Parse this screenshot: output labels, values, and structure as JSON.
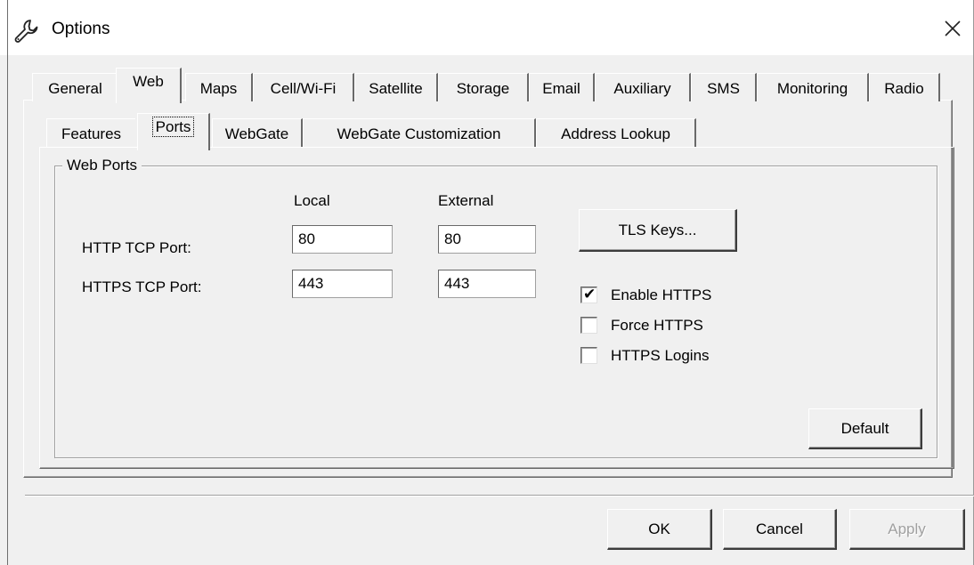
{
  "window": {
    "title": "Options",
    "icon": "wrench-icon",
    "close_icon": "close-icon"
  },
  "outer_tabs": [
    {
      "label": "General"
    },
    {
      "label": "Web"
    },
    {
      "label": "Maps"
    },
    {
      "label": "Cell/Wi-Fi"
    },
    {
      "label": "Satellite"
    },
    {
      "label": "Storage"
    },
    {
      "label": "Email"
    },
    {
      "label": "Auxiliary"
    },
    {
      "label": "SMS"
    },
    {
      "label": "Monitoring"
    },
    {
      "label": "Radio"
    }
  ],
  "outer_tab_active": "Web",
  "inner_tabs": [
    {
      "label": "Features"
    },
    {
      "label": "Ports"
    },
    {
      "label": "WebGate"
    },
    {
      "label": "WebGate Customization"
    },
    {
      "label": "Address Lookup"
    }
  ],
  "inner_tab_active": "Ports",
  "group": {
    "title": "Web Ports",
    "col_local": "Local",
    "col_external": "External",
    "http_label": "HTTP TCP Port:",
    "https_label": "HTTPS TCP Port:",
    "http_local": "80",
    "http_external": "80",
    "https_local": "443",
    "https_external": "443",
    "tls_button": "TLS Keys...",
    "enable_https": {
      "label": "Enable HTTPS",
      "checked": true
    },
    "force_https": {
      "label": "Force HTTPS",
      "checked": false
    },
    "https_logins": {
      "label": "HTTPS Logins",
      "checked": false
    },
    "default_button": "Default"
  },
  "footer": {
    "ok": "OK",
    "cancel": "Cancel",
    "apply": "Apply"
  }
}
